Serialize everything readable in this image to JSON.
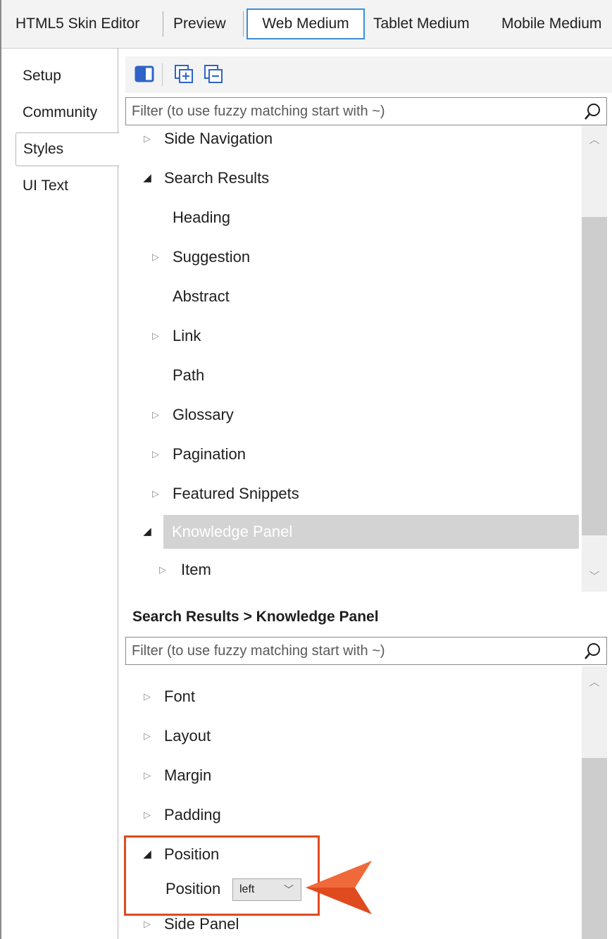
{
  "top_tabs": [
    {
      "label": "HTML5 Skin Editor"
    },
    {
      "label": "Preview"
    },
    {
      "label": "Web Medium"
    },
    {
      "label": "Tablet Medium"
    },
    {
      "label": "Mobile Medium"
    }
  ],
  "side_tabs": [
    {
      "label": "Setup"
    },
    {
      "label": "Community"
    },
    {
      "label": "Styles"
    },
    {
      "label": "UI Text"
    }
  ],
  "style_filter": {
    "placeholder": "Filter (to use fuzzy matching start with ~)"
  },
  "style_tree": [
    {
      "label": "Side Navigation"
    },
    {
      "label": "Search Results"
    },
    {
      "label": "Heading"
    },
    {
      "label": "Suggestion"
    },
    {
      "label": "Abstract"
    },
    {
      "label": "Link"
    },
    {
      "label": "Path"
    },
    {
      "label": "Glossary"
    },
    {
      "label": "Pagination"
    },
    {
      "label": "Featured Snippets"
    },
    {
      "label": "Knowledge Panel"
    },
    {
      "label": "Item"
    }
  ],
  "breadcrumb": "Search Results > Knowledge Panel",
  "property_filter": {
    "placeholder": "Filter (to use fuzzy matching start with ~)"
  },
  "property_tree": [
    {
      "label": "Font"
    },
    {
      "label": "Layout"
    },
    {
      "label": "Margin"
    },
    {
      "label": "Padding"
    },
    {
      "label": "Position"
    },
    {
      "label": "Position"
    },
    {
      "label": "Side Panel"
    }
  ],
  "position_select": {
    "value": "left"
  },
  "colors": {
    "accent": "#3b8fd6",
    "selected": "#d3d3d3",
    "callout": "#e04a1f"
  }
}
